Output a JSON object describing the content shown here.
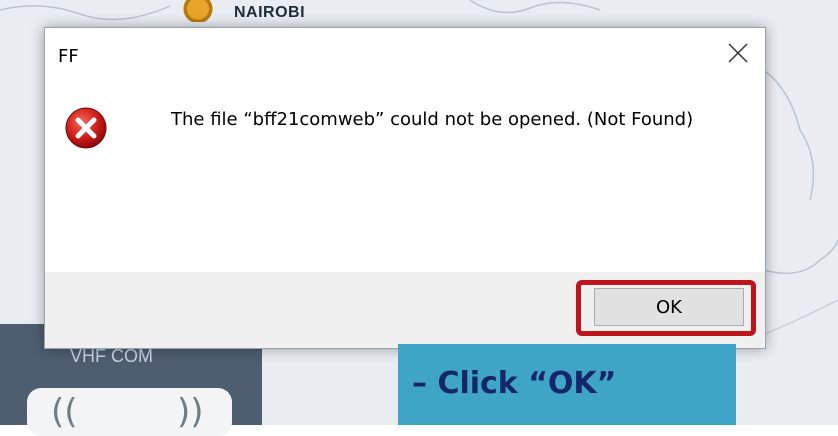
{
  "background": {
    "map_city_label": "NAIROBI",
    "panel_label": "VHF COM",
    "panel_color": "#4e5e70"
  },
  "dialog": {
    "title": "FF",
    "message": "The file “bff21comweb” could not be opened.  (Not Found)",
    "icon": "error-icon",
    "ok_label": "OK",
    "close_icon": "close-icon"
  },
  "callout": {
    "text": "– Click “OK”",
    "background_color": "#3fa5c6",
    "text_color": "#16266a"
  },
  "highlight": {
    "color": "#c0141c"
  }
}
